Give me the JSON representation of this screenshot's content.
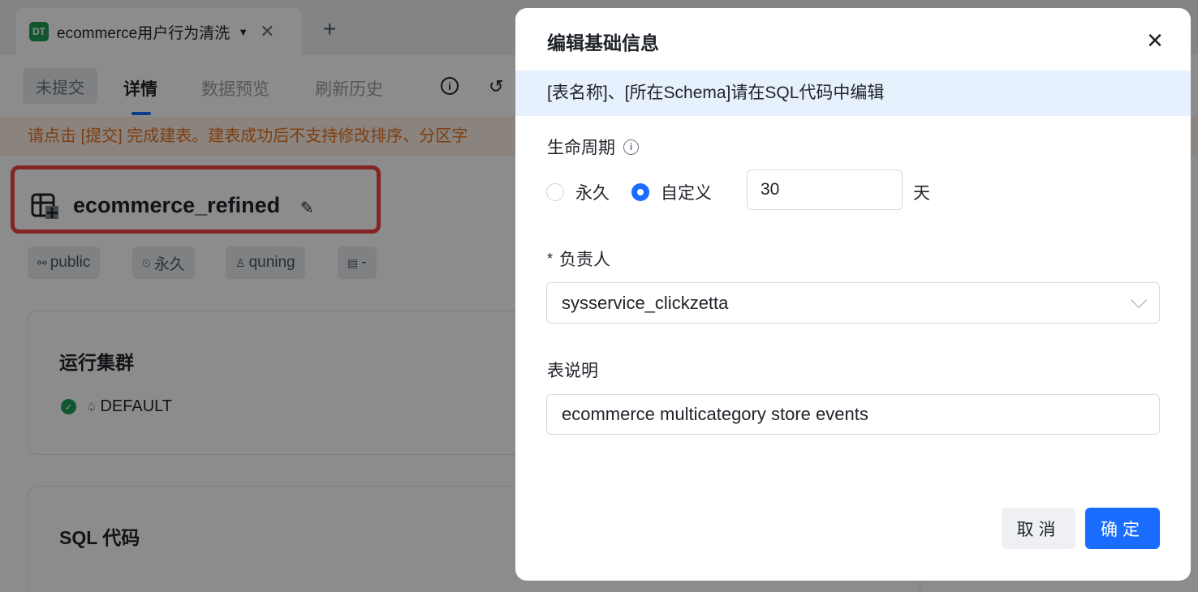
{
  "doc_tab": {
    "badge": "DT",
    "title": "ecommerce用户行为清洗",
    "caret": "▼",
    "close": "✕",
    "add": "+"
  },
  "subnav": {
    "status": "未提交",
    "tabs": [
      "详情",
      "数据预览",
      "刷新历史"
    ]
  },
  "warning": "请点击 [提交] 完成建表。建表成功后不支持修改排序、分区字",
  "table": {
    "name": "ecommerce_refined"
  },
  "chips": [
    {
      "icon": "⚯",
      "label": "public"
    },
    {
      "icon": "⏲",
      "label": "永久"
    },
    {
      "icon": "♙",
      "label": "quning"
    },
    {
      "icon": "▤",
      "label": "-"
    }
  ],
  "cluster_card": {
    "title": "运行集群",
    "cluster": "DEFAULT"
  },
  "sql_card": {
    "title": "SQL 代码"
  },
  "modal": {
    "title": "编辑基础信息",
    "close": "✕",
    "notice": "[表名称]、[所在Schema]请在SQL代码中编辑",
    "lifecycle": {
      "label": "生命周期",
      "help": "i",
      "options": [
        {
          "label": "永久",
          "checked": false
        },
        {
          "label": "自定义",
          "checked": true
        }
      ],
      "days_value": "30",
      "unit": "天"
    },
    "owner": {
      "required_mark": "*",
      "label": "负责人",
      "value": "sysservice_clickzetta"
    },
    "description": {
      "label": "表说明",
      "value": "ecommerce multicategory store events"
    },
    "buttons": {
      "cancel": "取消",
      "ok": "确定"
    }
  },
  "colors": {
    "accent": "#1a6cff",
    "warning": "#e3741f",
    "highlight": "#ef4444",
    "success": "#1f9d55"
  }
}
